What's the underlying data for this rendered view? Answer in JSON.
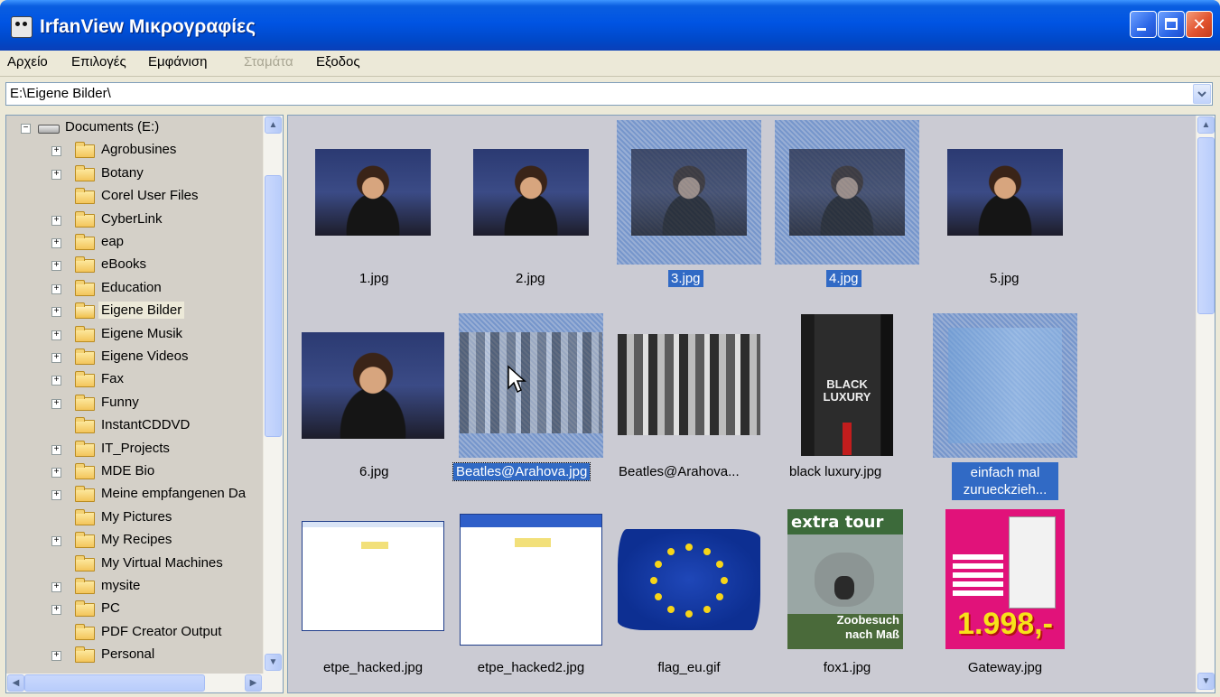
{
  "window": {
    "title": "IrfanView Μικρογραφίες"
  },
  "menu": {
    "file": "Αρχείο",
    "options": "Επιλογές",
    "view": "Εμφάνιση",
    "stop": "Σταμάτα",
    "exit": "Εξοδος"
  },
  "address": {
    "path": "E:\\Eigene Bilder\\"
  },
  "tree": {
    "root": "Documents (E:)",
    "items": [
      {
        "label": "Agrobusines",
        "expandable": true
      },
      {
        "label": "Botany",
        "expandable": true
      },
      {
        "label": "Corel User Files",
        "expandable": false
      },
      {
        "label": "CyberLink",
        "expandable": true
      },
      {
        "label": "eap",
        "expandable": true
      },
      {
        "label": "eBooks",
        "expandable": true
      },
      {
        "label": "Education",
        "expandable": true
      },
      {
        "label": "Eigene Bilder",
        "expandable": true,
        "selected": true
      },
      {
        "label": "Eigene Musik",
        "expandable": true
      },
      {
        "label": "Eigene Videos",
        "expandable": true
      },
      {
        "label": "Fax",
        "expandable": true
      },
      {
        "label": "Funny",
        "expandable": true
      },
      {
        "label": "InstantCDDVD",
        "expandable": false
      },
      {
        "label": "IT_Projects",
        "expandable": true
      },
      {
        "label": "MDE Bio",
        "expandable": true
      },
      {
        "label": "Meine empfangenen Da",
        "expandable": true
      },
      {
        "label": "My Pictures",
        "expandable": false
      },
      {
        "label": "My Recipes",
        "expandable": true
      },
      {
        "label": "My Virtual Machines",
        "expandable": false
      },
      {
        "label": "mysite",
        "expandable": true
      },
      {
        "label": "PC",
        "expandable": true
      },
      {
        "label": "PDF Creator Output",
        "expandable": false
      },
      {
        "label": "Personal",
        "expandable": true
      }
    ]
  },
  "thumbnails": [
    {
      "name": "1.jpg",
      "selected": false
    },
    {
      "name": "2.jpg",
      "selected": false
    },
    {
      "name": "3.jpg",
      "selected": true
    },
    {
      "name": "4.jpg",
      "selected": true
    },
    {
      "name": "5.jpg",
      "selected": false
    },
    {
      "name": "6.jpg",
      "selected": false
    },
    {
      "name": "Beatles@Arahova.jpg",
      "selected": true
    },
    {
      "name": "Beatles@Arahova...",
      "selected": false
    },
    {
      "name": "black luxury.jpg",
      "selected": false
    },
    {
      "name": "einfach mal zurueckzieh...",
      "selected": true
    },
    {
      "name": "etpe_hacked.jpg",
      "selected": false
    },
    {
      "name": "etpe_hacked2.jpg",
      "selected": false
    },
    {
      "name": "flag_eu.gif",
      "selected": false
    },
    {
      "name": "fox1.jpg",
      "selected": false
    },
    {
      "name": "Gateway.jpg",
      "selected": false
    }
  ],
  "image_text": {
    "black_luxury": "BLACK LUXURY",
    "fox_title": "extra tour",
    "fox_sub": "Zoobesuch nach Maß",
    "gateway_price": "1.998,-"
  },
  "colors": {
    "titlebar": "#0054e3",
    "selection": "#316ac5",
    "thumb_background": "#cbcbd3"
  }
}
